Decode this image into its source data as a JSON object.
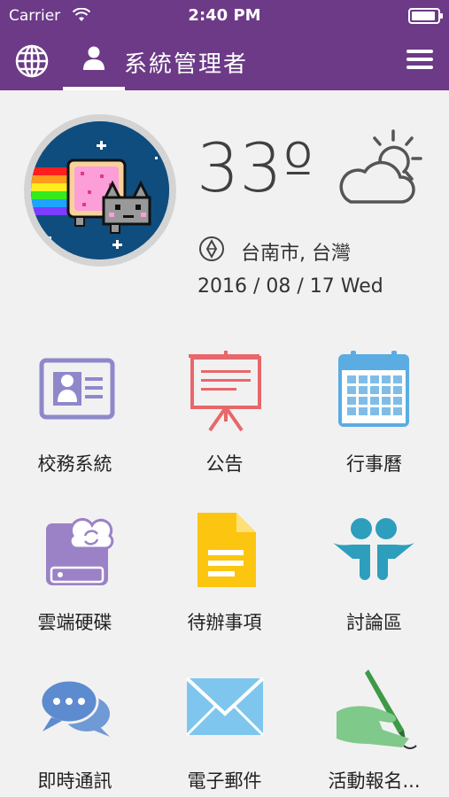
{
  "status_bar": {
    "carrier": "Carrier",
    "time": "2:40 PM"
  },
  "nav": {
    "title": "系統管理者"
  },
  "profile": {
    "temperature": "33º",
    "location": "台南市, 台灣",
    "date": "2016 / 08 / 17 Wed"
  },
  "apps": [
    {
      "label": "校務系統",
      "icon": "id-card-icon"
    },
    {
      "label": "公告",
      "icon": "presentation-board-icon"
    },
    {
      "label": "行事曆",
      "icon": "calendar-icon"
    },
    {
      "label": "雲端硬碟",
      "icon": "cloud-drive-icon"
    },
    {
      "label": "待辦事項",
      "icon": "document-icon"
    },
    {
      "label": "討論區",
      "icon": "people-icon"
    },
    {
      "label": "即時通訊",
      "icon": "chat-bubbles-icon"
    },
    {
      "label": "電子郵件",
      "icon": "envelope-icon"
    },
    {
      "label": "活動報名...",
      "icon": "signing-hand-icon"
    }
  ],
  "colors": {
    "nav": "#6c3a87",
    "background": "#f2f1f2"
  }
}
